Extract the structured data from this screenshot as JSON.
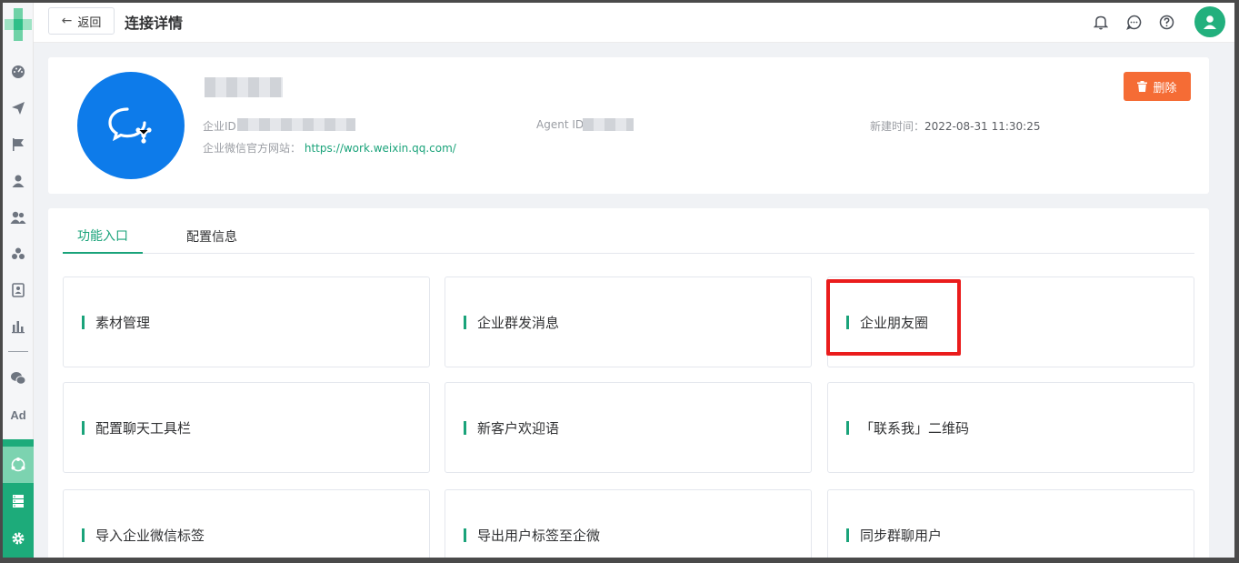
{
  "topbar": {
    "back_label": "返回",
    "title": "连接详情"
  },
  "sidebar": {
    "items": [
      {
        "icon": "dashboard-icon"
      },
      {
        "icon": "send-icon"
      },
      {
        "icon": "flag-icon"
      },
      {
        "icon": "user-icon"
      },
      {
        "icon": "users-icon"
      },
      {
        "icon": "groups-icon"
      },
      {
        "icon": "contact-card-icon"
      },
      {
        "icon": "bar-chart-icon"
      },
      {
        "icon": "wechat-icon"
      },
      {
        "icon": "ad-icon",
        "text": "Ad"
      },
      {
        "icon": "connect-icon",
        "active": true
      },
      {
        "icon": "server-icon"
      },
      {
        "icon": "gear-icon"
      }
    ]
  },
  "info": {
    "corp_id_label": "企业ID",
    "agent_id_label": "Agent ID",
    "created_label": "新建时间：",
    "created_value": "2022-08-31 11:30:25",
    "website_label": "企业微信官方网站：",
    "website_url": "https://work.weixin.qq.com/",
    "delete_label": "删除"
  },
  "tabs": [
    {
      "label": "功能入口",
      "active": true
    },
    {
      "label": "配置信息",
      "active": false
    }
  ],
  "features": [
    {
      "label": "素材管理"
    },
    {
      "label": "企业群发消息"
    },
    {
      "label": "企业朋友圈"
    },
    {
      "label": "配置聊天工具栏"
    },
    {
      "label": "新客户欢迎语"
    },
    {
      "label": "「联系我」二维码"
    },
    {
      "label": "导入企业微信标签"
    },
    {
      "label": "导出用户标签至企微"
    },
    {
      "label": "同步群聊用户"
    }
  ],
  "colors": {
    "accent": "#1aa37a",
    "delete": "#f56c35",
    "avatar_blue": "#0d7bea",
    "highlight": "#ea1c1c"
  }
}
